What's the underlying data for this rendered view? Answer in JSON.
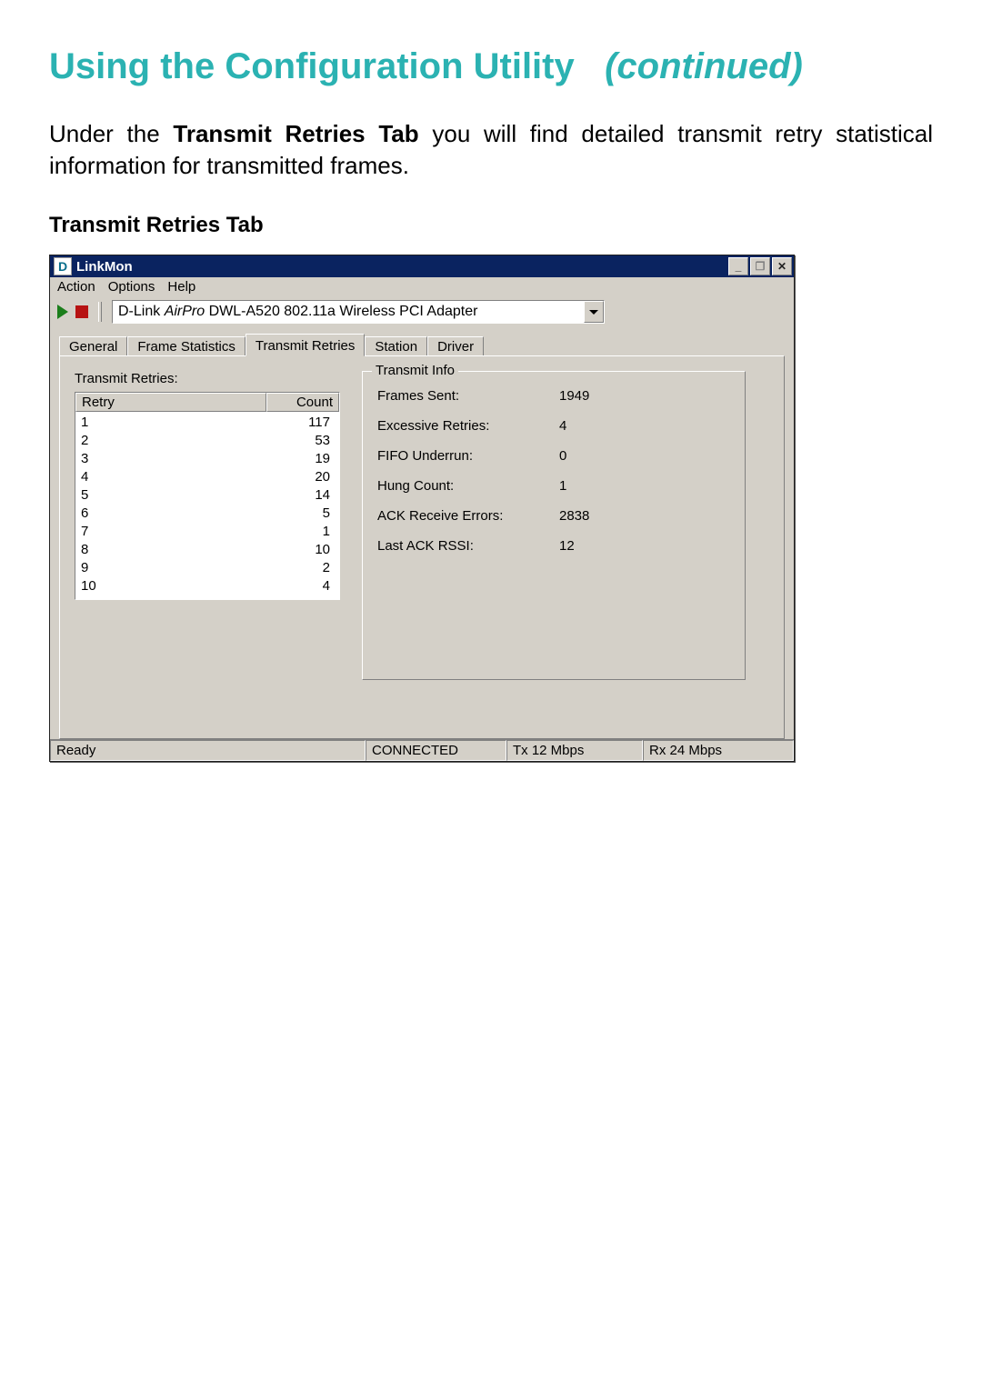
{
  "page_title_main": "Using the Configuration Utility",
  "page_title_cont": "(continued)",
  "intro_pre": "Under the ",
  "intro_bold": "Transmit Retries Tab",
  "intro_post": " you will find detailed transmit retry statistical information for transmitted frames.",
  "subheading": "Transmit Retries Tab",
  "window": {
    "title": "LinkMon",
    "menus": {
      "action": "Action",
      "options": "Options",
      "help": "Help"
    },
    "adapter_prefix": "D-Link ",
    "adapter_italic": "AirPro",
    "adapter_suffix": " DWL-A520 802.11a Wireless PCI Adapter",
    "tabs": {
      "general": "General",
      "frame_stats": "Frame Statistics",
      "transmit_retries": "Transmit Retries",
      "station": "Station",
      "driver": "Driver"
    },
    "retries_label": "Transmit Retries:",
    "retry_col": "Retry",
    "count_col": "Count",
    "retry_rows": [
      {
        "retry": "1",
        "count": "117"
      },
      {
        "retry": "2",
        "count": "53"
      },
      {
        "retry": "3",
        "count": "19"
      },
      {
        "retry": "4",
        "count": "20"
      },
      {
        "retry": "5",
        "count": "14"
      },
      {
        "retry": "6",
        "count": "5"
      },
      {
        "retry": "7",
        "count": "1"
      },
      {
        "retry": "8",
        "count": "10"
      },
      {
        "retry": "9",
        "count": "2"
      },
      {
        "retry": "10",
        "count": "4"
      }
    ],
    "info_legend": "Transmit Info",
    "info": {
      "frames_sent_label": "Frames Sent:",
      "frames_sent_value": "1949",
      "excessive_retries_label": "Excessive Retries:",
      "excessive_retries_value": "4",
      "fifo_underrun_label": "FIFO Underrun:",
      "fifo_underrun_value": "0",
      "hung_count_label": "Hung Count:",
      "hung_count_value": "1",
      "ack_recv_err_label": "ACK Receive Errors:",
      "ack_recv_err_value": "2838",
      "last_ack_rssi_label": "Last ACK RSSI:",
      "last_ack_rssi_value": "12"
    },
    "status": {
      "ready": "Ready",
      "connected": "CONNECTED",
      "tx": "Tx 12 Mbps",
      "rx": "Rx 24 Mbps"
    }
  }
}
